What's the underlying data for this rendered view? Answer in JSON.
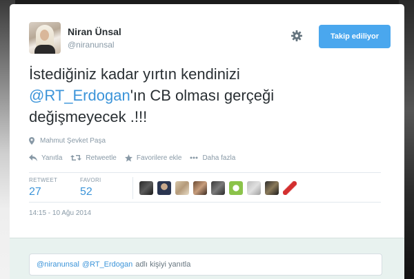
{
  "user": {
    "name": "Niran Ünsal",
    "handle": "@niranunsal"
  },
  "follow_button": {
    "label": "Takip ediliyor"
  },
  "tweet": {
    "line1": "İstediğiniz kadar yırtın kendinizi",
    "mention": "@RT_Erdogan",
    "line2_rest": "'ın CB olması gerçeği",
    "line3": "değişmeyecek  .!!!"
  },
  "location": "Mahmut Şevket Paşa",
  "actions": {
    "reply": "Yanıtla",
    "retweet": "Retweetle",
    "favorite": "Favorilere ekle",
    "more": "Daha fazla"
  },
  "stats": {
    "retweet_label": "RETWEET",
    "retweet_count": "27",
    "favorite_label": "FAVORI",
    "favorite_count": "52"
  },
  "timestamp": "14:15 - 10 Ağu 2014",
  "reply": {
    "mention1": "@niranunsal",
    "mention2": "@RT_Erdogan",
    "suffix": "adlı kişiyi yanıtla"
  },
  "colors": {
    "accent": "#3b94d9",
    "button": "#4aa7ee",
    "muted": "#8899a6"
  },
  "icons": [
    "location-pin-icon",
    "reply-icon",
    "retweet-icon",
    "star-icon",
    "more-icon",
    "gear-icon"
  ]
}
